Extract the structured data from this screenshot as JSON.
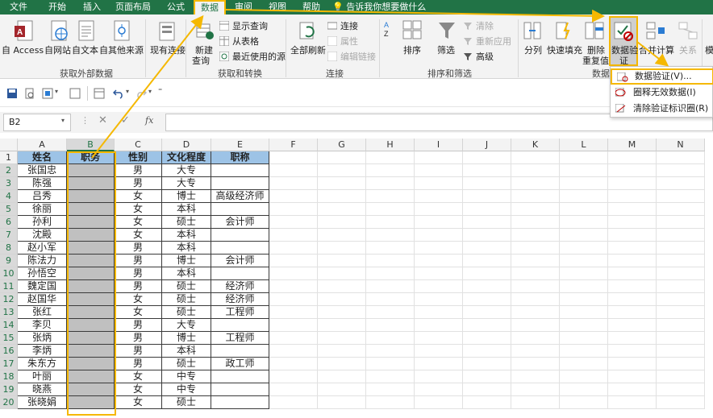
{
  "tabs": [
    "文件",
    "开始",
    "插入",
    "页面布局",
    "公式",
    "数据",
    "审阅",
    "视图",
    "帮助"
  ],
  "active_tab": "数据",
  "tellme": "告诉我你想要做什么",
  "ribbon": {
    "get_external": {
      "access": "自 Access",
      "web": "自网站",
      "text": "自文本",
      "other": "自其他来源",
      "existing": "现有连接",
      "group_label": "获取外部数据"
    },
    "get_transform": {
      "new_query": [
        "新建",
        "查询"
      ],
      "show_queries": "显示查询",
      "from_table": "从表格",
      "recent_sources": "最近使用的源",
      "group_label": "获取和转换"
    },
    "connections": {
      "refresh_all": "全部刷新",
      "connections": "连接",
      "properties": "属性",
      "edit_links": "编辑链接",
      "group_label": "连接"
    },
    "sort_filter": {
      "sort": "排序",
      "filter": "筛选",
      "clear": "清除",
      "reapply": "重新应用",
      "advanced": "高级",
      "group_label": "排序和筛选"
    },
    "data_tools": {
      "text_to_columns": "分列",
      "flash_fill": "快速填充",
      "remove_duplicates": [
        "删除",
        "重复值"
      ],
      "data_validation": [
        "数据验",
        "证"
      ],
      "consolidate": "合并计算",
      "relationships": "关系",
      "group_label": "数据",
      "overflow": "模"
    }
  },
  "dropdown": {
    "items": [
      "数据验证(V)...",
      "圈释无效数据(I)",
      "清除验证标识圈(R)"
    ]
  },
  "formula_bar": {
    "name_box": "B2",
    "fx": "fx"
  },
  "columns": [
    "A",
    "B",
    "C",
    "D",
    "E",
    "F",
    "G",
    "H",
    "I",
    "J",
    "K",
    "L",
    "M",
    "N"
  ],
  "rows": [
    "1",
    "2",
    "3",
    "4",
    "5",
    "6",
    "7",
    "8",
    "9",
    "10",
    "11",
    "12",
    "13",
    "14",
    "15",
    "16",
    "17",
    "18",
    "19",
    "20"
  ],
  "sheet": {
    "headers": [
      "姓名",
      "职务",
      "性别",
      "文化程度",
      "职称"
    ],
    "data": [
      [
        "张国忠",
        "",
        "男",
        "大专",
        ""
      ],
      [
        "陈强",
        "",
        "男",
        "大专",
        ""
      ],
      [
        "吕秀",
        "",
        "女",
        "博士",
        "高级经济师"
      ],
      [
        "徐丽",
        "",
        "女",
        "本科",
        ""
      ],
      [
        "孙利",
        "",
        "女",
        "硕士",
        "会计师"
      ],
      [
        "沈殿",
        "",
        "女",
        "本科",
        ""
      ],
      [
        "赵小军",
        "",
        "男",
        "本科",
        ""
      ],
      [
        "陈法力",
        "",
        "男",
        "博士",
        "会计师"
      ],
      [
        "孙悟空",
        "",
        "男",
        "本科",
        ""
      ],
      [
        "魏定国",
        "",
        "男",
        "硕士",
        "经济师"
      ],
      [
        "赵国华",
        "",
        "女",
        "硕士",
        "经济师"
      ],
      [
        "张红",
        "",
        "女",
        "硕士",
        "工程师"
      ],
      [
        "李贝",
        "",
        "男",
        "大专",
        ""
      ],
      [
        "张炳",
        "",
        "男",
        "博士",
        "工程师"
      ],
      [
        "李炳",
        "",
        "男",
        "本科",
        ""
      ],
      [
        "朱东方",
        "",
        "男",
        "硕士",
        "政工师"
      ],
      [
        "叶丽",
        "",
        "女",
        "中专",
        ""
      ],
      [
        "晓燕",
        "",
        "女",
        "中专",
        ""
      ],
      [
        "张晓娟",
        "",
        "女",
        "硕士",
        ""
      ]
    ]
  },
  "colors": {
    "excel_green": "#217346",
    "highlight": "#f5b800",
    "header_fill": "#9dc3e6",
    "grey_fill": "#c0c0c0"
  }
}
